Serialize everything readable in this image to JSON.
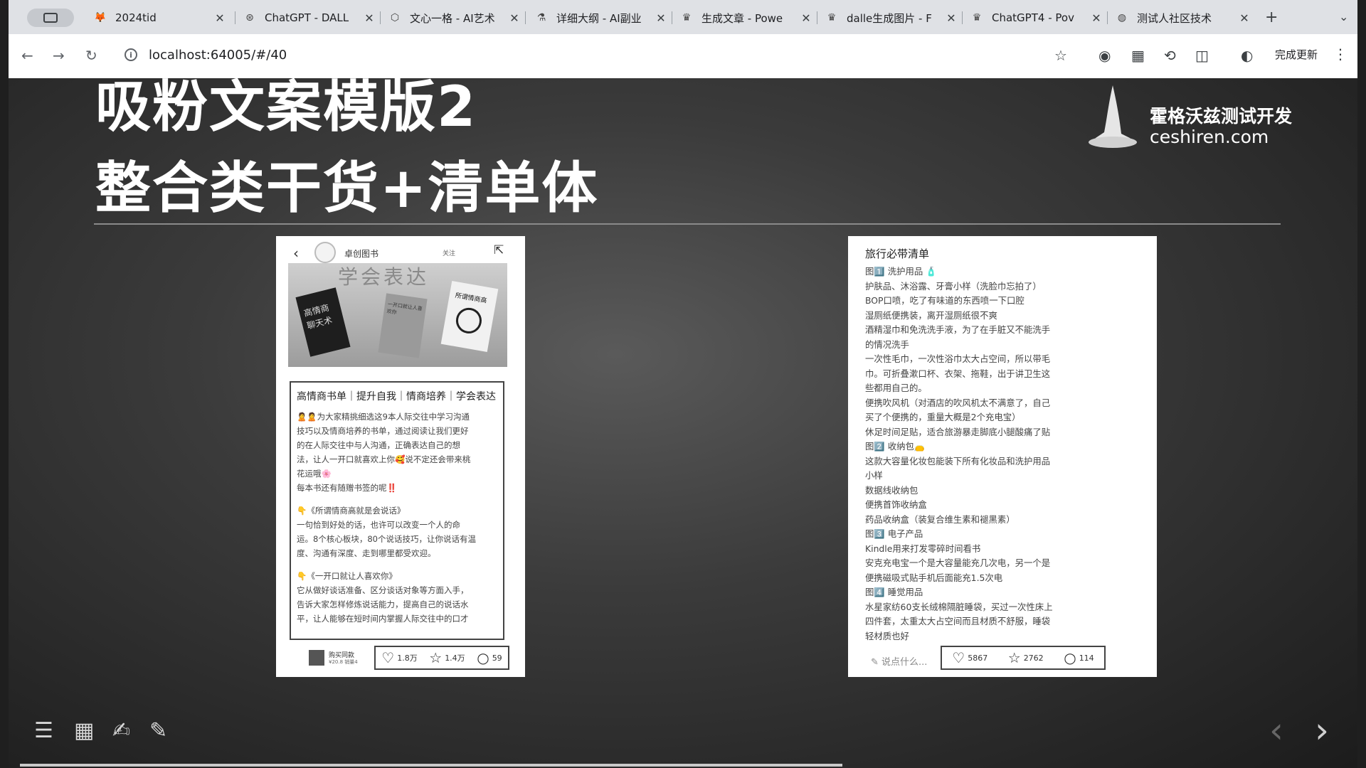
{
  "browser": {
    "tabs": [
      {
        "title": "2024tid",
        "icon": "gitlab-icon"
      },
      {
        "title": "ChatGPT - DALL",
        "icon": "openai-icon"
      },
      {
        "title": "文心一格 - AI艺术",
        "icon": "cube-icon"
      },
      {
        "title": "详细大纲 - AI副业",
        "icon": "flask-icon"
      },
      {
        "title": "生成文章 - Powe",
        "icon": "crown-icon"
      },
      {
        "title": "dalle生成图片 - F",
        "icon": "crown-icon"
      },
      {
        "title": "ChatGPT4 - Pov",
        "icon": "crown-icon"
      },
      {
        "title": "测试人社区技术",
        "icon": "globe-icon"
      }
    ],
    "url": "localhost:64005/#/40",
    "update_label": "完成更新"
  },
  "slide": {
    "title_line1": "吸粉文案模版2",
    "title_line2": "整合类干货+清单体",
    "brand_name": "霍格沃兹测试开发",
    "brand_site": "ceshiren.com"
  },
  "card1": {
    "author": "卓创图书",
    "follow": "关注",
    "banner_text": "学会表达",
    "book1": "高情商聊天术",
    "book2": "一开口就让人喜欢你",
    "book3": "所谓情商高",
    "post_title": "高情商书单｜提升自我｜情商培养｜学会表达",
    "post_lines": [
      "🙎🙎为大家精挑细选这9本人际交往中学习沟通",
      "技巧以及情商培养的书单，通过阅读让我们更好",
      "的在人际交往中与人沟通，正确表达自己的想",
      "法，让人一开口就喜欢上你🥰说不定还会带来桃",
      "花运哦🌸",
      "每本书还有随赠书签的呢‼️",
      "",
      "👇《所谓情商高就是会说话》",
      "一句恰到好处的话，也许可以改变一个人的命",
      "运。8个核心板块，80个说话技巧，让你说话有温",
      "度、沟通有深度、走到哪里都受欢迎。",
      "",
      "👇《一开口就让人喜欢你》",
      "它从做好谈话准备、区分谈话对象等方面入手，",
      "告诉大家怎样修炼说话能力，提高自己的说话水",
      "平，让人能够在短时间内掌握人际交往中的口才"
    ],
    "buy_label": "购买同款",
    "buy_price": "¥20.8 销量4",
    "likes": "1.8万",
    "collects": "1.4万",
    "comments": "59"
  },
  "card2": {
    "title": "旅行必带清单",
    "lines": [
      "图1️⃣ 洗护用品 🧴",
      "护肤品、沐浴露、牙膏小样（洗脸巾忘拍了）",
      "BOP口喷，吃了有味道的东西喷一下口腔",
      "湿厕纸便携装，离开湿厕纸很不爽",
      "酒精湿巾和免洗洗手液，为了在手脏又不能洗手",
      "的情况洗手",
      "一次性毛巾，一次性浴巾太大占空间，所以带毛",
      "巾。可折叠漱口杯、衣架、拖鞋，出于讲卫生这",
      "些都用自己的。",
      "便携吹风机（对酒店的吹风机太不满意了，自己",
      "买了个便携的，重量大概是2个充电宝）",
      "休足时间足贴，适合旅游暴走脚底小腿酸痛了贴",
      "图2️⃣ 收纳包👝",
      "这款大容量化妆包能装下所有化妆品和洗护用品",
      "小样",
      "数据线收纳包",
      "便携首饰收纳盒",
      "药品收纳盒（装复合维生素和褪黑素）",
      "图3️⃣ 电子产品",
      "Kindle用来打发零碎时间看书",
      "安克充电宝一个是大容量能充几次电，另一个是",
      "便携磁吸式贴手机后面能充1.5次电",
      "图4️⃣ 睡觉用品",
      "水星家纺60支长绒棉隔脏睡袋，买过一次性床上",
      "四件套，太重太大占空间而且材质不舒服，睡袋",
      "轻材质也好"
    ],
    "say_placeholder": "说点什么...",
    "likes": "5867",
    "collects": "2762",
    "comments": "114"
  },
  "slide_progress": 0.62
}
